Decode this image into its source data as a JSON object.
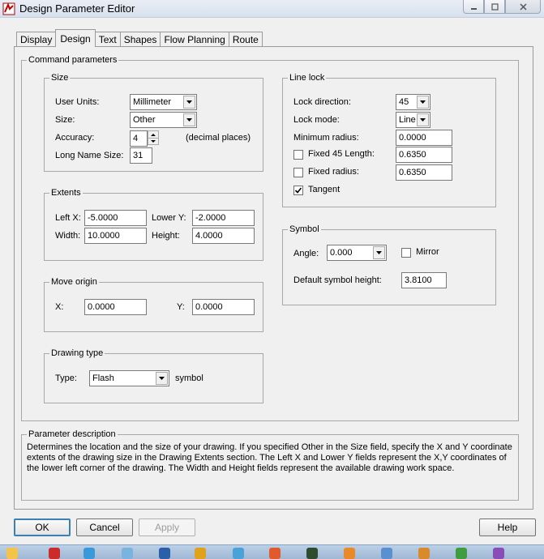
{
  "window": {
    "title": "Design Parameter Editor",
    "icon": "app-logo-icon"
  },
  "tabs": [
    {
      "label": "Display",
      "active": false
    },
    {
      "label": "Design",
      "active": true
    },
    {
      "label": "Text",
      "active": false
    },
    {
      "label": "Shapes",
      "active": false
    },
    {
      "label": "Flow Planning",
      "active": false
    },
    {
      "label": "Route",
      "active": false
    }
  ],
  "command_parameters": {
    "legend": "Command parameters",
    "size": {
      "legend": "Size",
      "user_units_label": "User Units:",
      "user_units_value": "Millimeter",
      "size_label": "Size:",
      "size_value": "Other",
      "accuracy_label": "Accuracy:",
      "accuracy_value": "4",
      "accuracy_hint": "(decimal places)",
      "long_name_label": "Long Name Size:",
      "long_name_value": "31"
    },
    "extents": {
      "legend": "Extents",
      "left_x_label": "Left X:",
      "left_x_value": "-5.0000",
      "lower_y_label": "Lower Y:",
      "lower_y_value": "-2.0000",
      "width_label": "Width:",
      "width_value": "10.0000",
      "height_label": "Height:",
      "height_value": "4.0000"
    },
    "move_origin": {
      "legend": "Move origin",
      "x_label": "X:",
      "x_value": "0.0000",
      "y_label": "Y:",
      "y_value": "0.0000"
    },
    "drawing_type": {
      "legend": "Drawing type",
      "type_label": "Type:",
      "type_value": "Flash",
      "suffix": "symbol"
    },
    "line_lock": {
      "legend": "Line lock",
      "lock_direction_label": "Lock direction:",
      "lock_direction_value": "45",
      "lock_mode_label": "Lock mode:",
      "lock_mode_value": "Line",
      "min_radius_label": "Minimum radius:",
      "min_radius_value": "0.0000",
      "fixed45_label": "Fixed 45 Length:",
      "fixed45_value": "0.6350",
      "fixed45_checked": false,
      "fixed_radius_label": "Fixed radius:",
      "fixed_radius_value": "0.6350",
      "fixed_radius_checked": false,
      "tangent_label": "Tangent",
      "tangent_checked": true
    },
    "symbol": {
      "legend": "Symbol",
      "angle_label": "Angle:",
      "angle_value": "0.000",
      "mirror_label": "Mirror",
      "mirror_checked": false,
      "default_height_label": "Default symbol height:",
      "default_height_value": "3.8100"
    }
  },
  "parameter_description": {
    "legend": "Parameter description",
    "line1": "Determines the location and the size of your drawing.  If you specified Other in the Size field, specify the X and Y coordinate",
    "line2": "extents of the drawing size in the Drawing Extents section. The Left X and Lower Y fields represent the X,Y coordinates of",
    "line3": "the lower left corner of the drawing.  The Width and Height fields represent the available drawing work space."
  },
  "buttons": {
    "ok": "OK",
    "cancel": "Cancel",
    "apply": "Apply",
    "help": "Help"
  }
}
